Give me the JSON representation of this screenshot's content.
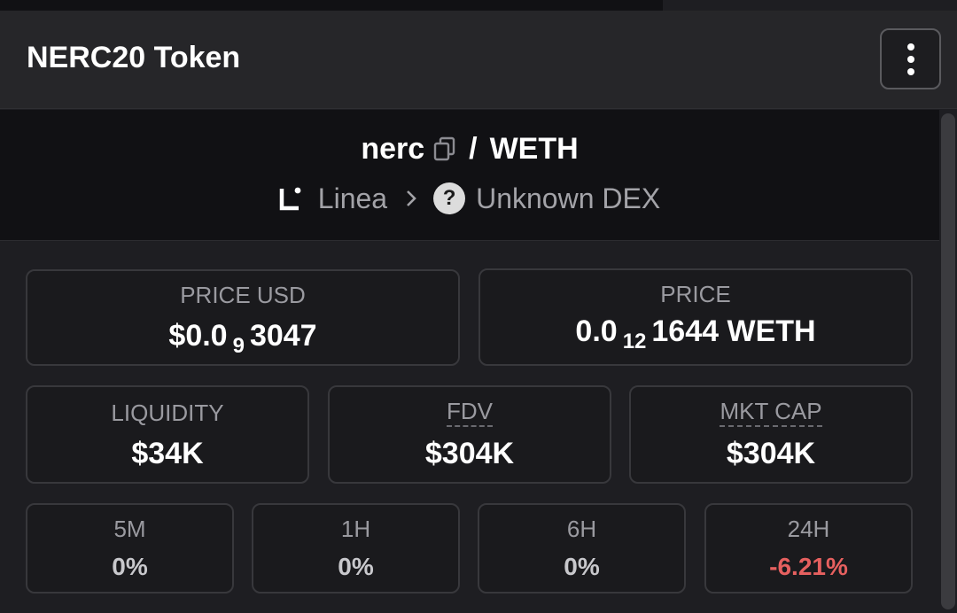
{
  "header": {
    "title": "NERC20 Token"
  },
  "pair": {
    "base": "nerc",
    "separator": "/",
    "quote": "WETH",
    "chain": "Linea",
    "dex": "Unknown DEX"
  },
  "prices": {
    "usd_label": "PRICE USD",
    "usd_prefix": "$0.0",
    "usd_zeros": "9",
    "usd_digits": "3047",
    "native_label": "PRICE",
    "native_prefix": "0.0",
    "native_zeros": "12",
    "native_digits": "1644 WETH"
  },
  "stats": {
    "liquidity_label": "LIQUIDITY",
    "liquidity_value": "$34K",
    "fdv_label": "FDV",
    "fdv_value": "$304K",
    "mktcap_label": "MKT CAP",
    "mktcap_value": "$304K"
  },
  "changes": [
    {
      "label": "5M",
      "value": "0%"
    },
    {
      "label": "1H",
      "value": "0%"
    },
    {
      "label": "6H",
      "value": "0%"
    },
    {
      "label": "24H",
      "value": "-6.21%"
    }
  ],
  "icons": [
    "kebab-menu-icon",
    "copy-icon",
    "linea-logo-icon",
    "chevron-right-icon",
    "question-icon"
  ],
  "colors": {
    "negative": "#e6605f",
    "background": "#1e1e22",
    "panel": "#111114"
  }
}
